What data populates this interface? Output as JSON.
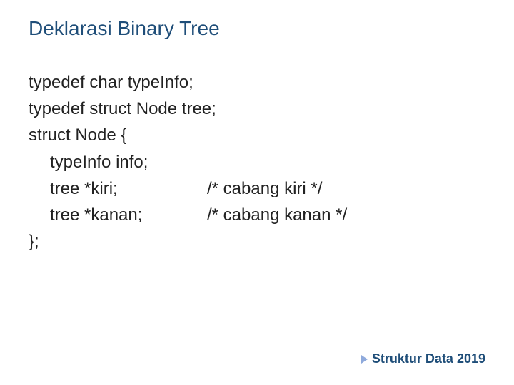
{
  "title": "Deklarasi Binary Tree",
  "code": {
    "line1": "typedef char typeInfo;",
    "line2": "typedef struct Node tree;",
    "line3": "struct Node {",
    "line4": "typeInfo info;",
    "line5_left": "tree *kiri;",
    "line5_comment": "/* cabang kiri */",
    "line6_left": "tree *kanan;",
    "line6_comment": "/* cabang kanan */",
    "line7": "};"
  },
  "footer": "Struktur Data 2019"
}
